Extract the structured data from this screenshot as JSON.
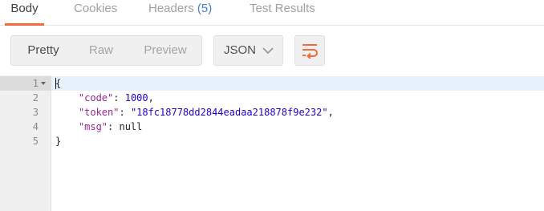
{
  "tabs": [
    {
      "label": "Body",
      "active": true
    },
    {
      "label": "Cookies",
      "active": false
    },
    {
      "label": "Headers",
      "count": "(5)",
      "active": false
    },
    {
      "label": "Test Results",
      "active": false
    }
  ],
  "toolbar": {
    "view_modes": [
      "Pretty",
      "Raw",
      "Preview"
    ],
    "active_mode": "Pretty",
    "format_select": "JSON",
    "wrap_icon": "wrap-lines-icon"
  },
  "editor": {
    "line_numbers": [
      "1",
      "2",
      "3",
      "4",
      "5"
    ],
    "lines": {
      "l1": "{",
      "l2": {
        "indent": "    ",
        "key": "\"code\"",
        "sep": ": ",
        "value": "1000",
        "end": ","
      },
      "l3": {
        "indent": "    ",
        "key": "\"token\"",
        "sep": ": ",
        "value": "\"18fc18778dd2844eadaa218878f9e232\"",
        "end": ","
      },
      "l4": {
        "indent": "    ",
        "key": "\"msg\"",
        "sep": ": ",
        "value": "null",
        "end": ""
      },
      "l5": "}"
    }
  },
  "colors": {
    "accent": "#f26b3a",
    "count": "#3f7fd6",
    "json_key": "#9b2393",
    "json_value": "#1c00cf"
  }
}
